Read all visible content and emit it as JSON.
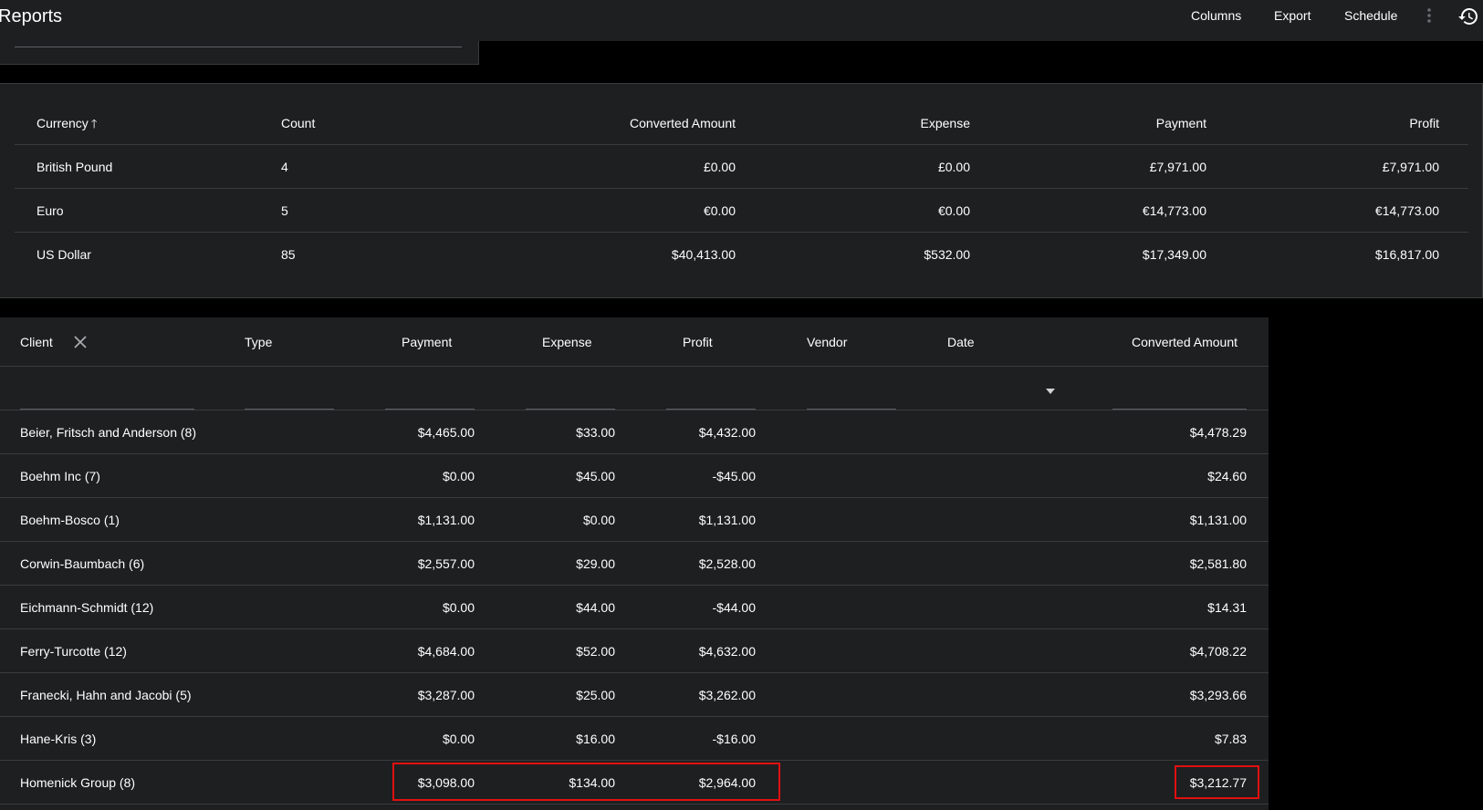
{
  "app": {
    "title": "Reports",
    "actions": {
      "columns": "Columns",
      "export": "Export",
      "schedule": "Schedule"
    },
    "icons": {
      "more": "more-vert-icon",
      "history": "history-icon"
    }
  },
  "summary": {
    "headers": {
      "currency": "Currency",
      "count": "Count",
      "converted_amount": "Converted Amount",
      "expense": "Expense",
      "payment": "Payment",
      "profit": "Profit"
    },
    "sort_indicator": "ascending",
    "rows": [
      {
        "currency": "British Pound",
        "count": "4",
        "converted_amount": "£0.00",
        "expense": "£0.00",
        "payment": "£7,971.00",
        "profit": "£7,971.00"
      },
      {
        "currency": "Euro",
        "count": "5",
        "converted_amount": "€0.00",
        "expense": "€0.00",
        "payment": "€14,773.00",
        "profit": "€14,773.00"
      },
      {
        "currency": "US Dollar",
        "count": "85",
        "converted_amount": "$40,413.00",
        "expense": "$532.00",
        "payment": "$17,349.00",
        "profit": "$16,817.00"
      }
    ]
  },
  "detail": {
    "headers": {
      "client": "Client",
      "type": "Type",
      "payment": "Payment",
      "expense": "Expense",
      "profit": "Profit",
      "vendor": "Vendor",
      "date": "Date",
      "converted_amount": "Converted Amount"
    },
    "rows": [
      {
        "client": "Beier, Fritsch and Anderson (8)",
        "payment": "$4,465.00",
        "expense": "$33.00",
        "profit": "$4,432.00",
        "converted_amount": "$4,478.29"
      },
      {
        "client": "Boehm Inc (7)",
        "payment": "$0.00",
        "expense": "$45.00",
        "profit": "-$45.00",
        "converted_amount": "$24.60"
      },
      {
        "client": "Boehm-Bosco (1)",
        "payment": "$1,131.00",
        "expense": "$0.00",
        "profit": "$1,131.00",
        "converted_amount": "$1,131.00"
      },
      {
        "client": "Corwin-Baumbach (6)",
        "payment": "$2,557.00",
        "expense": "$29.00",
        "profit": "$2,528.00",
        "converted_amount": "$2,581.80"
      },
      {
        "client": "Eichmann-Schmidt (12)",
        "payment": "$0.00",
        "expense": "$44.00",
        "profit": "-$44.00",
        "converted_amount": "$14.31"
      },
      {
        "client": "Ferry-Turcotte (12)",
        "payment": "$4,684.00",
        "expense": "$52.00",
        "profit": "$4,632.00",
        "converted_amount": "$4,708.22"
      },
      {
        "client": "Franecki, Hahn and Jacobi (5)",
        "payment": "$3,287.00",
        "expense": "$25.00",
        "profit": "$3,262.00",
        "converted_amount": "$3,293.66"
      },
      {
        "client": "Hane-Kris (3)",
        "payment": "$0.00",
        "expense": "$16.00",
        "profit": "-$16.00",
        "converted_amount": "$7.83"
      },
      {
        "client": "Homenick Group (8)",
        "payment": "$3,098.00",
        "expense": "$134.00",
        "profit": "$2,964.00",
        "converted_amount": "$3,212.77"
      }
    ]
  },
  "colors": {
    "highlight": "#e01010",
    "surface": "#1e1f21",
    "background": "#000000"
  }
}
